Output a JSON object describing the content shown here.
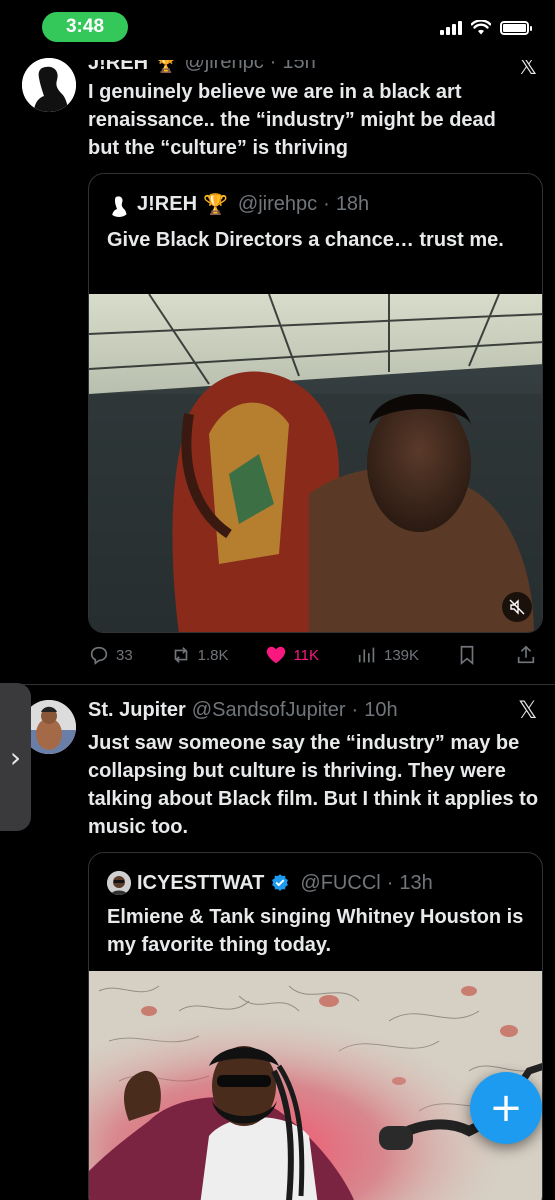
{
  "status_bar": {
    "time": "3:48"
  },
  "post1": {
    "name": "J!REH 🏆",
    "handle": "@jirehpc",
    "time": "15h",
    "text": "I genuinely believe we are in a black art renaissance.. the “industry” might be dead but the “culture” is thriving",
    "quote": {
      "name": "J!REH",
      "trophy": "🏆",
      "handle": "@jirehpc",
      "time": "18h",
      "text": "Give Black Directors a chance… trust me."
    },
    "actions": {
      "replies": "33",
      "reposts": "1.8K",
      "likes": "11K",
      "views": "139K"
    }
  },
  "post2": {
    "name": "St. Jupiter",
    "handle": "@SandsofJupiter",
    "time": "10h",
    "text": "Just saw someone say the “industry” may be collapsing but culture is thriving. They were talking about Black film. But I think it applies to music too.",
    "quote": {
      "name": "ICYESTTWAT",
      "handle": "@FUCCl",
      "time": "13h",
      "text": "Elmiene & Tank singing Whitney Houston is my favorite thing today."
    }
  },
  "separator": "·",
  "icons": {
    "x_logo": "x-logo-icon",
    "verified": "verified-badge-icon",
    "mute": "mute-icon",
    "compose": "compose-plus-icon",
    "side_tab": "chevron-right-icon"
  },
  "colors": {
    "accent": "#1d9bf0",
    "like": "#f91880",
    "status_pill": "#34c759",
    "muted_text": "#71767b"
  }
}
